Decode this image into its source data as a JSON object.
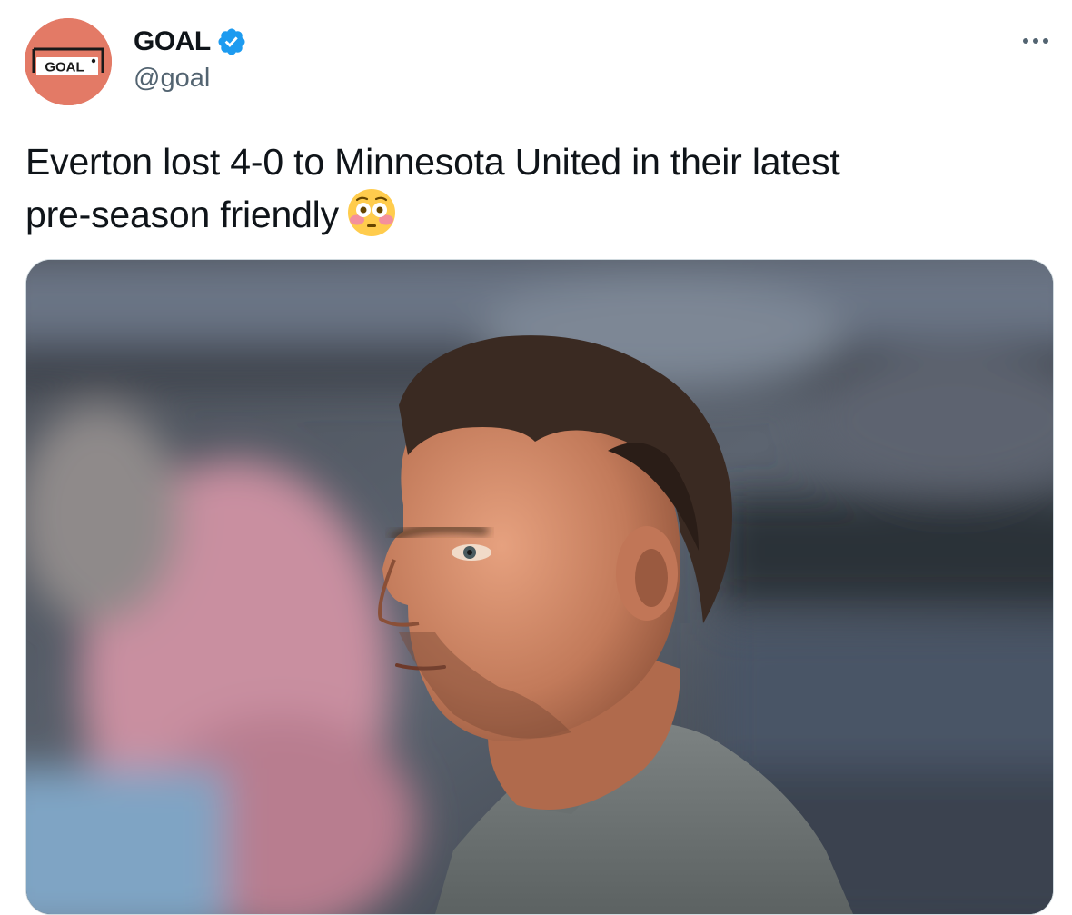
{
  "account": {
    "display_name": "GOAL",
    "handle": "@goal",
    "verified": true,
    "avatar_logo_text": "GOAL",
    "avatar_color": "#e37a66"
  },
  "tweet": {
    "text_line_1": "Everton lost 4-0 to Minnesota United in their latest",
    "text_line_2": "pre-season friendly",
    "emoji": "flushed-face"
  },
  "icons": {
    "verified": "verified-badge-icon",
    "more": "more-options-icon"
  },
  "colors": {
    "verified_blue": "#1d9bf0",
    "text": "#0f1419",
    "secondary_text": "#536471"
  }
}
